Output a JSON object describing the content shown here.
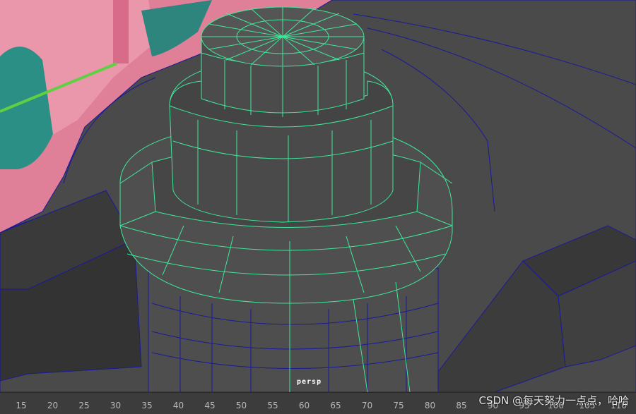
{
  "viewport": {
    "camera_label": "persp",
    "colors": {
      "mesh_fill": "#4d4d4d",
      "mesh_dark": "#2e2e2e",
      "selected_wire": "#3fe89a",
      "unselected_wire": "#1a1aa0",
      "background_pink": "#e8809a",
      "teal_object": "#2a8a80",
      "green_line": "#5cd040"
    }
  },
  "timeline": {
    "ticks": [
      "15",
      "20",
      "25",
      "30",
      "35",
      "40",
      "45",
      "50",
      "55",
      "60",
      "65",
      "70",
      "75",
      "80",
      "85",
      "90",
      "95",
      "100",
      "105",
      "110"
    ]
  },
  "watermark": {
    "text": "CSDN @每天努力一点点，哈哈"
  }
}
